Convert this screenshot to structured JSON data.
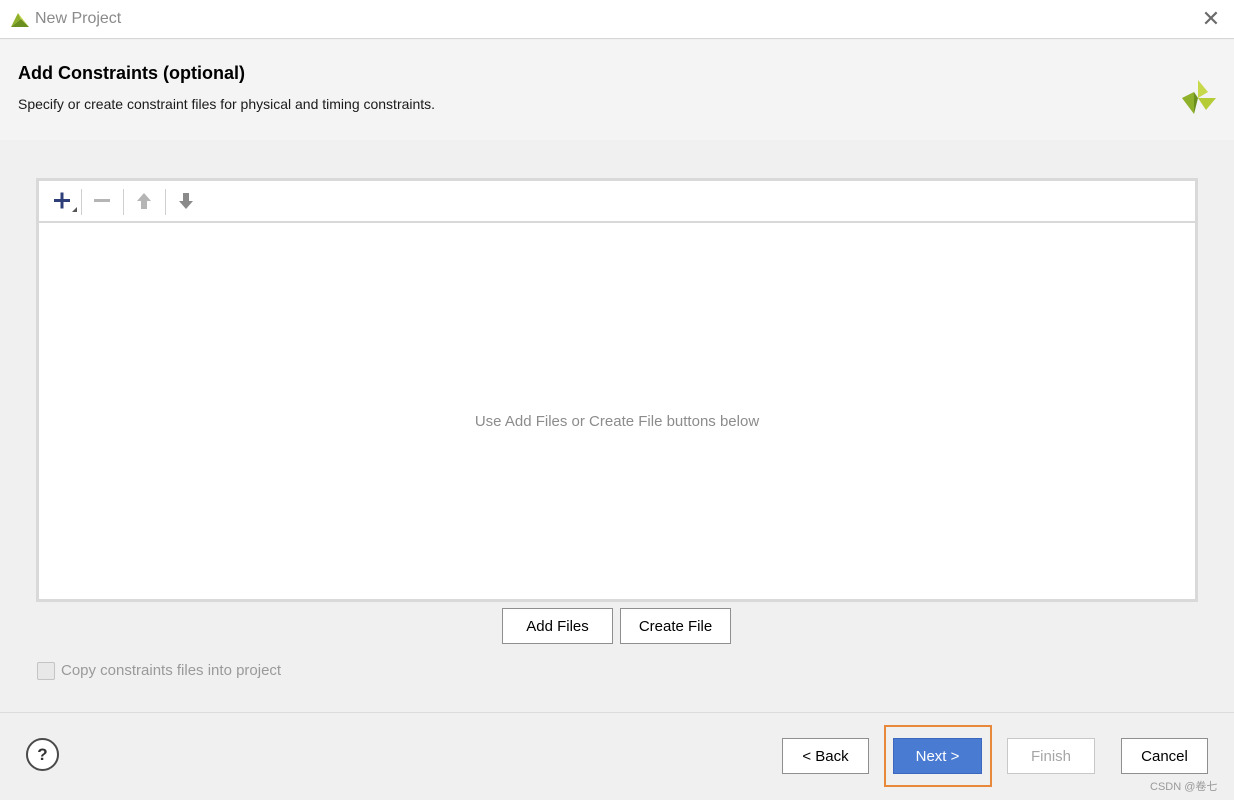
{
  "window": {
    "title": "New Project"
  },
  "header": {
    "title": "Add Constraints (optional)",
    "subtitle": "Specify or create constraint files for physical and timing constraints."
  },
  "toolbar": {
    "icons": [
      "plus-icon",
      "minus-icon",
      "move-up-icon",
      "move-down-icon"
    ]
  },
  "file_list": {
    "empty_hint": "Use Add Files or Create File buttons below"
  },
  "actions": {
    "add_files_label": "Add Files",
    "create_file_label": "Create File"
  },
  "options": {
    "copy_constraints_label": "Copy constraints files into project",
    "copy_constraints_checked": false
  },
  "footer": {
    "help_label": "?",
    "back_label": "< Back",
    "next_label": "Next >",
    "finish_label": "Finish",
    "cancel_label": "Cancel"
  },
  "watermark": "CSDN @卷七",
  "colors": {
    "accent": "#4a7bd3",
    "highlight": "#e8883a",
    "logo_green": "#9bbf2a"
  }
}
